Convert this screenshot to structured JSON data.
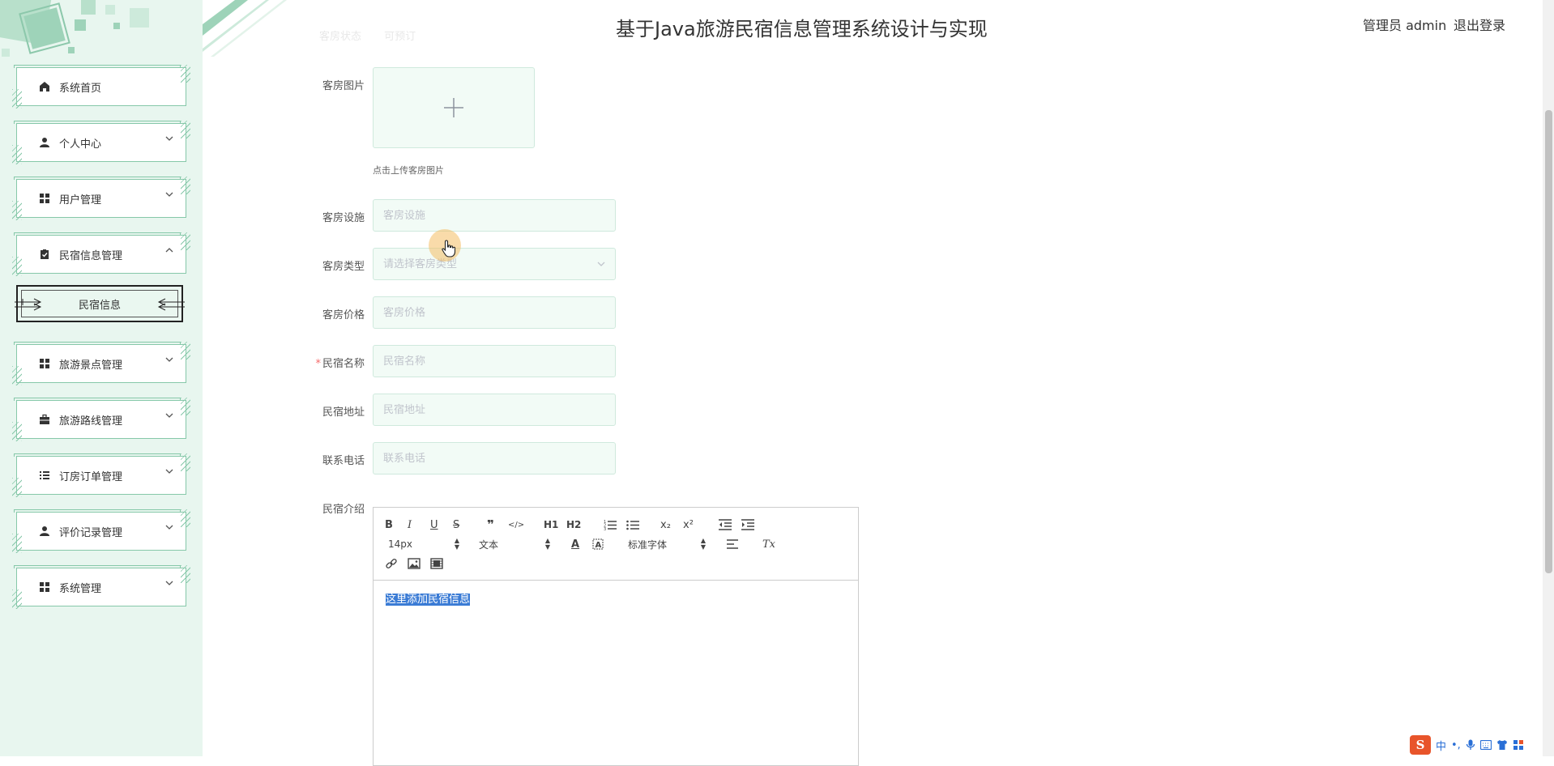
{
  "app": {
    "title": "基于Java旅游民宿信息管理系统设计与实现",
    "user_role": "管理员 admin",
    "logout_label": "退出登录"
  },
  "sidebar": {
    "items": [
      {
        "label": "系统首页",
        "icon": "home-icon",
        "chevron": "none"
      },
      {
        "label": "个人中心",
        "icon": "user-icon",
        "chevron": "down"
      },
      {
        "label": "用户管理",
        "icon": "grid-icon",
        "chevron": "down"
      },
      {
        "label": "民宿信息管理",
        "icon": "clipboard-check-icon",
        "chevron": "up"
      },
      {
        "label": "旅游景点管理",
        "icon": "grid-icon",
        "chevron": "down"
      },
      {
        "label": "旅游路线管理",
        "icon": "briefcase-icon",
        "chevron": "down"
      },
      {
        "label": "订房订单管理",
        "icon": "list-icon",
        "chevron": "down"
      },
      {
        "label": "评价记录管理",
        "icon": "user-icon",
        "chevron": "down"
      },
      {
        "label": "系统管理",
        "icon": "grid-icon",
        "chevron": "down"
      }
    ],
    "submenu_active": "民宿信息"
  },
  "form": {
    "faded_label": "客房状态",
    "faded_value": "可预订",
    "image_label": "客房图片",
    "upload_hint": "点击上传客房图片",
    "facilities": {
      "label": "客房设施",
      "placeholder": "客房设施",
      "value": ""
    },
    "room_type": {
      "label": "客房类型",
      "placeholder": "请选择客房类型",
      "value": ""
    },
    "price": {
      "label": "客房价格",
      "placeholder": "客房价格",
      "value": ""
    },
    "homestay_name": {
      "label": "民宿名称",
      "placeholder": "民宿名称",
      "value": "",
      "required": true
    },
    "address": {
      "label": "民宿地址",
      "placeholder": "民宿地址",
      "value": ""
    },
    "phone": {
      "label": "联系电话",
      "placeholder": "联系电话",
      "value": ""
    },
    "intro": {
      "label": "民宿介绍",
      "content": "这里添加民宿信息"
    }
  },
  "editor": {
    "font_size": "14px",
    "header_style": "文本",
    "font_family": "标准字体",
    "buttons": {
      "bold": "B",
      "italic": "I",
      "underline": "U",
      "strike": "S",
      "quote": "❞",
      "code": "</>",
      "h1": "H1",
      "h2": "H2",
      "subscript": "x₂",
      "superscript": "x²",
      "clean": "Tx"
    }
  },
  "ime": {
    "logo": "S",
    "mode": "中",
    "punct": "•,"
  },
  "colors": {
    "sidebar_bg": "#e8f6ef",
    "accent": "#86c8a9",
    "required": "#f56c6c",
    "selection": "#3a7bd5"
  }
}
